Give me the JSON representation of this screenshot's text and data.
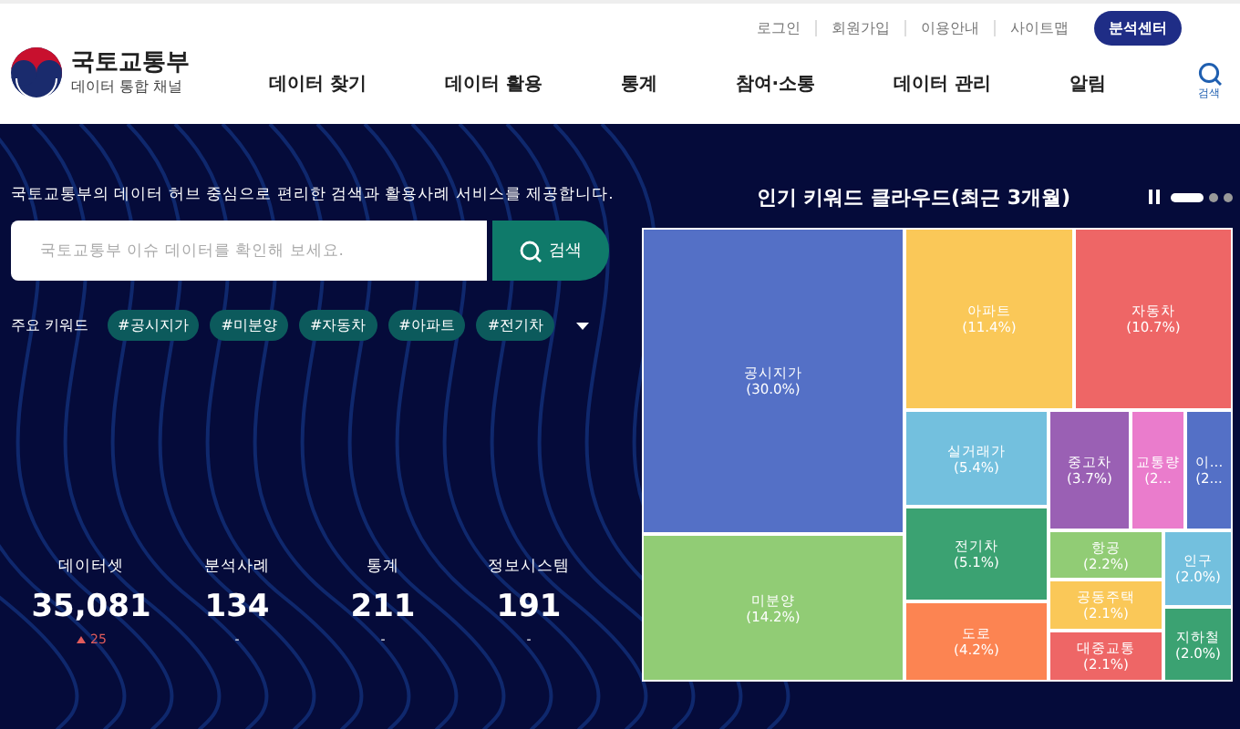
{
  "header": {
    "logo": {
      "title": "국토교통부",
      "subtitle": "데이터 통합 채널"
    },
    "utility_links": [
      "로그인",
      "회원가입",
      "이용안내",
      "사이트맵"
    ],
    "analysis_button": "분석센터",
    "nav": [
      "데이터 찾기",
      "데이터 활용",
      "통계",
      "참여·소통",
      "데이터 관리",
      "알림"
    ],
    "search_label": "검색"
  },
  "hero": {
    "intro": "국토교통부의 데이터 허브 중심으로 편리한 검색과 활용사례 서비스를 제공합니다.",
    "search": {
      "placeholder": "국토교통부 이슈 데이터를 확인해 보세요.",
      "button": "검색"
    },
    "keywords_label": "주요 키워드",
    "keywords": [
      "#공시지가",
      "#미분양",
      "#자동차",
      "#아파트",
      "#전기차"
    ]
  },
  "stats": [
    {
      "label": "데이터셋",
      "value": "35,081",
      "change": "25",
      "increased": true
    },
    {
      "label": "분석사례",
      "value": "134",
      "change": "-",
      "increased": false
    },
    {
      "label": "통계",
      "value": "211",
      "change": "-",
      "increased": false
    },
    {
      "label": "정보시스템",
      "value": "191",
      "change": "-",
      "increased": false
    }
  ],
  "keyword_cloud": {
    "title": "인기 키워드 클라우드(최근 3개월)",
    "pages": [
      {
        "selected": true
      },
      {
        "selected": false
      },
      {
        "selected": false
      }
    ],
    "tiles": [
      {
        "label": "공시지가",
        "share": "(30.0%)",
        "color": "#5470c6"
      },
      {
        "label": "미분양",
        "share": "(14.2%)",
        "color": "#91cc75"
      },
      {
        "label": "아파트",
        "share": "(11.4%)",
        "color": "#fac858"
      },
      {
        "label": "자동차",
        "share": "(10.7%)",
        "color": "#ee6666"
      },
      {
        "label": "실거래가",
        "share": "(5.4%)",
        "color": "#73c0de"
      },
      {
        "label": "전기차",
        "share": "(5.1%)",
        "color": "#3ba272"
      },
      {
        "label": "도로",
        "share": "(4.2%)",
        "color": "#fc8452"
      },
      {
        "label": "중고차",
        "share": "(3.7%)",
        "color": "#9a60b4"
      },
      {
        "label": "교통량",
        "share": "(2...",
        "color": "#ea7ccc"
      },
      {
        "label": "이...",
        "share": "(2...",
        "color": "#5470c6"
      },
      {
        "label": "항공",
        "share": "(2.2%)",
        "color": "#91cc75"
      },
      {
        "label": "공동주택",
        "share": "(2.1%)",
        "color": "#fac858"
      },
      {
        "label": "대중교통",
        "share": "(2.1%)",
        "color": "#ee6666"
      },
      {
        "label": "인구",
        "share": "(2.0%)",
        "color": "#73c0de"
      },
      {
        "label": "지하철",
        "share": "(2.0%)",
        "color": "#3ba272"
      }
    ]
  }
}
